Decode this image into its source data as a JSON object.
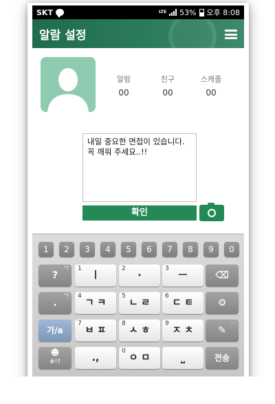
{
  "status_bar": {
    "carrier": "SKT",
    "network": "LTE",
    "battery": "53%",
    "time": "오후 8:08"
  },
  "header": {
    "title": "알람 설정"
  },
  "profile": {
    "stats": [
      {
        "label": "알람",
        "value": "00"
      },
      {
        "label": "친구",
        "value": "00"
      },
      {
        "label": "스케줄",
        "value": "00"
      }
    ]
  },
  "message": {
    "line1": "내일 중요한 면접이 있습니다.",
    "line2": "꼭 깨워 주세요..!!"
  },
  "actions": {
    "confirm_label": "확인"
  },
  "keyboard": {
    "numbers": [
      "1",
      "2",
      "3",
      "4",
      "5",
      "6",
      "7",
      "8",
      "9",
      "0"
    ],
    "row1": [
      {
        "sup": "?",
        "main": "?"
      },
      {
        "sup": "1",
        "main": "ㅣ"
      },
      {
        "sup": "2",
        "main": "·"
      },
      {
        "sup": "3",
        "main": "ㅡ"
      }
    ],
    "row2": [
      {
        "sup": ".",
        "main": "."
      },
      {
        "sup": "4",
        "main": "ㄱ ㅋ"
      },
      {
        "sup": "5",
        "main": "ㄴ ㄹ"
      },
      {
        "sup": "6",
        "main": "ㄷ ㅌ"
      }
    ],
    "row3": [
      {
        "sup": "7",
        "main": "ㅂ ㅍ"
      },
      {
        "sup": "8",
        "main": "ㅅ ㅎ"
      },
      {
        "sup": "9",
        "main": "ㅈ ㅊ"
      }
    ],
    "row4": [
      {
        "sup": "",
        "main": ".,"
      },
      {
        "sup": "0",
        "main": "ㅇ ㅁ"
      }
    ],
    "lang_label": "가/a",
    "emoji_label": "#!?",
    "send_label": "전송"
  }
}
